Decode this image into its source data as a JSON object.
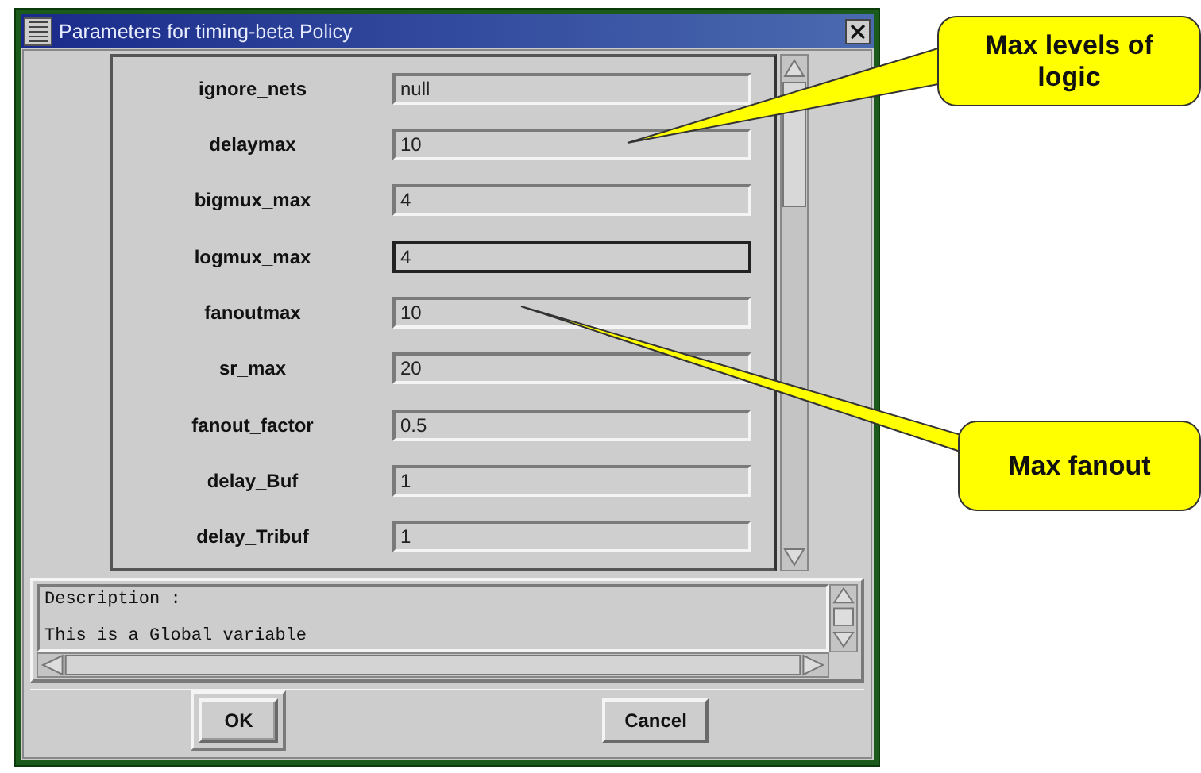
{
  "window": {
    "title": "Parameters for timing-beta Policy"
  },
  "parameters": [
    {
      "name": "ignore_nets",
      "value": "null",
      "focused": false
    },
    {
      "name": "delaymax",
      "value": "10",
      "focused": false
    },
    {
      "name": "bigmux_max",
      "value": "4",
      "focused": false
    },
    {
      "name": "logmux_max",
      "value": "4",
      "focused": true
    },
    {
      "name": "fanoutmax",
      "value": "10",
      "focused": false
    },
    {
      "name": "sr_max",
      "value": "20",
      "focused": false
    },
    {
      "name": "fanout_factor",
      "value": "0.5",
      "focused": false
    },
    {
      "name": "delay_Buf",
      "value": "1",
      "focused": false
    },
    {
      "name": "delay_Tribuf",
      "value": "1",
      "focused": false
    }
  ],
  "description": {
    "heading": "Description :",
    "text": "This is a Global variable"
  },
  "buttons": [
    {
      "label": "OK",
      "default": true
    },
    {
      "label": "Cancel",
      "default": false
    }
  ],
  "callouts": [
    {
      "text": "Max levels of logic"
    },
    {
      "text": "Max fanout"
    }
  ]
}
